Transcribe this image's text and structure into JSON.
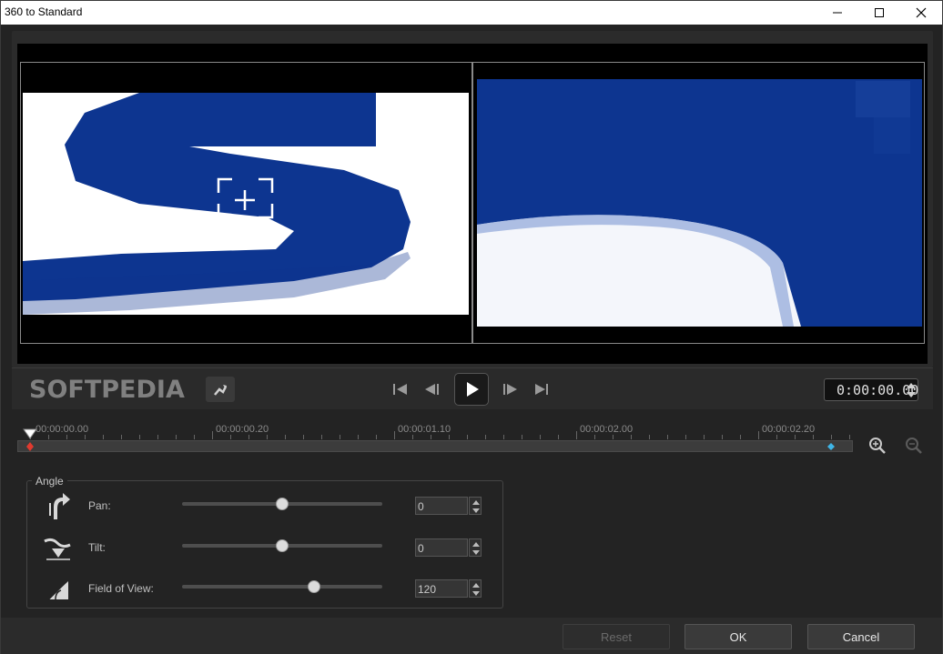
{
  "window": {
    "title": "360 to Standard"
  },
  "watermark": {
    "text": "SOFTPEDIA"
  },
  "player": {
    "timecode": "0:00:00.00"
  },
  "timeline": {
    "ticks": [
      "00:00:00.00",
      "00:00:00.20",
      "00:00:01.10",
      "00:00:02.00",
      "00:00:02.20"
    ]
  },
  "angle": {
    "group_label": "Angle",
    "pan": {
      "label": "Pan:",
      "value": "0",
      "level": 0.5
    },
    "tilt": {
      "label": "Tilt:",
      "value": "0",
      "level": 0.5
    },
    "fov": {
      "label": "Field of View:",
      "value": "120",
      "level": 0.66
    }
  },
  "buttons": {
    "reset": "Reset",
    "ok": "OK",
    "cancel": "Cancel"
  },
  "colors": {
    "logo_blue": "#0d3590",
    "keyframe_blue": "#3fb6e8",
    "keyframe_red": "#e03a2f"
  },
  "icons": [
    "minimize-icon",
    "maximize-icon",
    "close-icon",
    "rotate-icon",
    "skip-to-start-icon",
    "step-back-icon",
    "play-icon",
    "step-forward-icon",
    "skip-to-end-icon",
    "zoom-in-icon",
    "zoom-out-icon",
    "pan-icon",
    "tilt-icon",
    "field-of-view-icon"
  ]
}
